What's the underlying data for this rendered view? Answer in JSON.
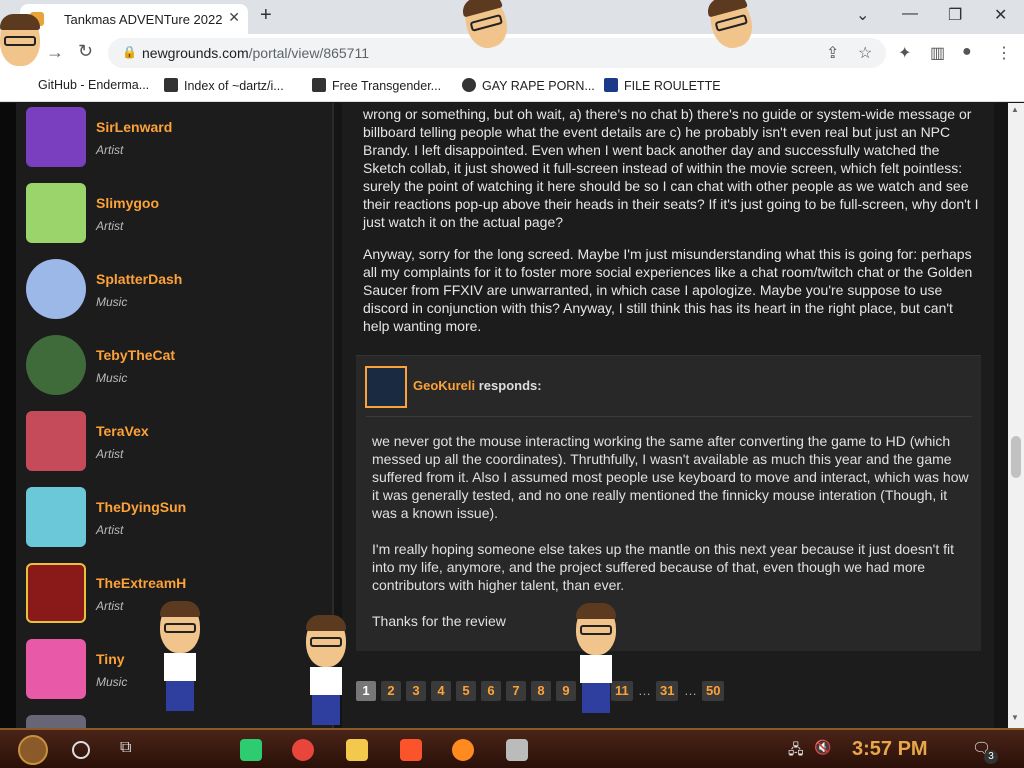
{
  "browser": {
    "tab_title": "Tankmas ADVENTure 2022",
    "close_glyph": "✕",
    "new_tab_glyph": "+",
    "url_host": "newgrounds.com",
    "url_path": "/portal/view/865711",
    "bookmarks": [
      "GitHub - Enderma...",
      "Index of ~dartz/i...",
      "Free Transgender...",
      "GAY RAPE PORN...",
      "FILE ROULETTE"
    ]
  },
  "sidebar": {
    "members": [
      {
        "name": "SirLenward",
        "role": "Artist",
        "color": "#7a3fbf"
      },
      {
        "name": "Slimygoo",
        "role": "Artist",
        "color": "#9bd46a"
      },
      {
        "name": "SplatterDash",
        "role": "Music",
        "color": "#9bb8e8"
      },
      {
        "name": "TebyTheCat",
        "role": "Music",
        "color": "#3f6b3a"
      },
      {
        "name": "TeraVex",
        "role": "Artist",
        "color": "#c54a5a"
      },
      {
        "name": "TheDyingSun",
        "role": "Artist",
        "color": "#6bc8d8"
      },
      {
        "name": "TheExtreamH",
        "role": "Artist",
        "color": "#8a1a1a"
      },
      {
        "name": "Tiny",
        "role": "Music",
        "color": "#e85aa8"
      }
    ]
  },
  "review": {
    "paragraphs": [
      "wrong or something, but oh wait, a) there's no chat b) there's no guide or system-wide message or billboard telling people what the event details are c) he probably isn't even real but just an NPC Brandy. I left disappointed. Even when I went back another day and successfully watched the Sketch collab, it just showed it full-screen instead of within the movie screen, which felt pointless: surely the point of watching it here should be so I can chat with other people as we watch and see their reactions pop-up above their heads in their seats? If it's just going to be full-screen, why don't I just watch it on the actual page?",
      "Anyway, sorry for the long screed. Maybe I'm just misunderstanding what this is going for: perhaps all my complaints for it to foster more social experiences like a chat room/twitch chat or the Golden Saucer from FFXIV are unwarranted, in which case I apologize. Maybe you're suppose to use discord in conjunction with this? Anyway, I still think this has its heart in the right place, but can't help wanting more."
    ]
  },
  "response": {
    "author": "GeoKureli",
    "verb": "responds:",
    "paragraphs": [
      "we never got the mouse interacting working the same after converting the game to HD (which messed up all the coordinates). Thruthfully, I wasn't available as much this year and the game suffered from it. Also I assumed most people use keyboard to move and interact, which was how it was generally tested, and no one really mentioned the finnicky mouse interation (Though, it was a known issue).",
      "I'm really hoping someone else takes up the mantle on this next year because it just doesn't fit into my life, anymore, and the project suffered because of that, even though we had more contributors with higher talent, than ever.",
      "Thanks for the review"
    ]
  },
  "pagination": {
    "pages": [
      "1",
      "2",
      "3",
      "4",
      "5",
      "6",
      "7",
      "8",
      "9",
      "11",
      "31",
      "50"
    ],
    "current": "1",
    "ellipsis": "…"
  },
  "taskbar": {
    "time": "3:57 PM",
    "notification_count": "3"
  },
  "colors": {
    "accent": "#fda238",
    "page_bg": "#1c1c1c"
  }
}
